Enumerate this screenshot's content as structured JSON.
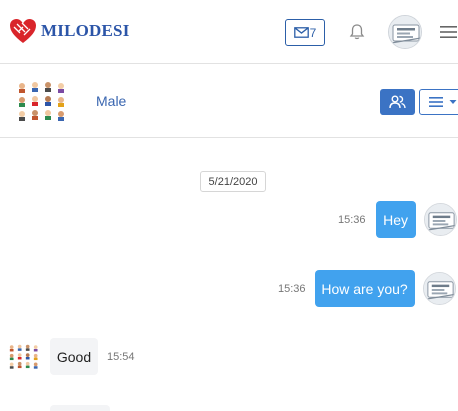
{
  "app": {
    "logo_first": "M",
    "logo_rest": "ILODESI",
    "logo_icon": "heart-logo-icon",
    "brand_blue": "#2c55a8",
    "brand_red": "#d9252b"
  },
  "topnav": {
    "mail_count": "7",
    "mail_icon": "envelope-icon",
    "bell_icon": "bell-icon",
    "menu_icon": "hamburger-icon"
  },
  "chat": {
    "name": "Male",
    "members_icon": "users-icon",
    "menu_icon": "list-icon",
    "accent": "#3b73c4"
  },
  "messages": {
    "date": "5/21/2020",
    "items": [
      {
        "direction": "outgoing",
        "text": "Hey",
        "time": "15:36"
      },
      {
        "direction": "outgoing",
        "text": "How are you?",
        "time": "15:36"
      },
      {
        "direction": "incoming",
        "text": "Good",
        "time": "15:54"
      }
    ],
    "bubble_out_color": "#41a2ee",
    "bubble_in_color": "#f3f4f6"
  }
}
